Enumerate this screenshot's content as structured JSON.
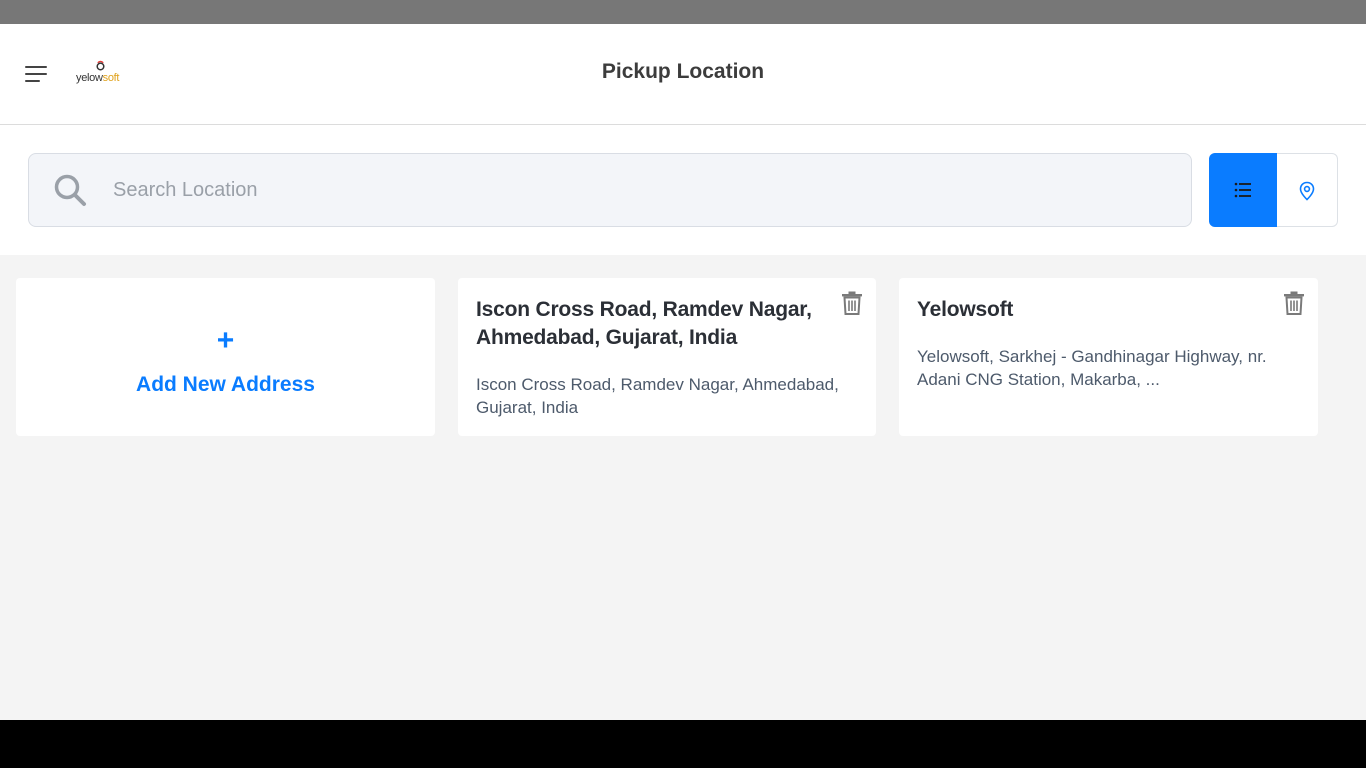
{
  "header": {
    "title": "Pickup Location",
    "logo": {
      "text_part1": "yelow",
      "text_part2": "soft"
    }
  },
  "search": {
    "placeholder": "Search Location",
    "value": ""
  },
  "view_toggle": {
    "active": "list",
    "options": [
      "list-icon",
      "map-pin-icon"
    ]
  },
  "cards": {
    "add": {
      "plus": "+",
      "label": "Add New Address"
    },
    "addresses": [
      {
        "title": "Iscon Cross Road, Ramdev Nagar, Ahmedabad, Gujarat, India",
        "description": "Iscon Cross Road, Ramdev Nagar, Ahmedabad, Gujarat, India"
      },
      {
        "title": "Yelowsoft",
        "description": "Yelowsoft, Sarkhej - Gandhinagar Highway, nr. Adani CNG Station, Makarba, ..."
      }
    ]
  },
  "colors": {
    "accent": "#0a7cff",
    "status_bar": "#777777",
    "content_bg": "#f4f4f4"
  }
}
